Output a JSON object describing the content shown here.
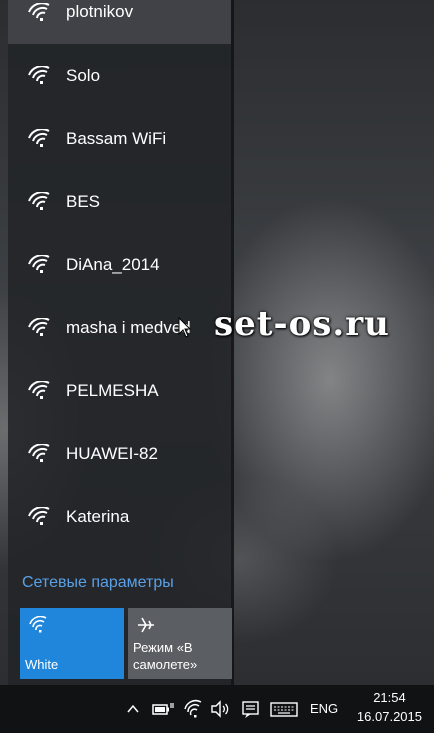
{
  "networks": [
    {
      "name": "plotnikov",
      "selected": true
    },
    {
      "name": "Solo"
    },
    {
      "name": "Bassam WiFi"
    },
    {
      "name": "BES"
    },
    {
      "name": "DiAna_2014"
    },
    {
      "name": "masha i medved"
    },
    {
      "name": "PELMESHA"
    },
    {
      "name": "HUAWEI-82"
    },
    {
      "name": "Katerina"
    }
  ],
  "network_settings_label": "Сетевые параметры",
  "quick_actions": {
    "wifi_label": "White",
    "airplane_label": "Режим «В самолете»"
  },
  "watermark": "set-os.ru",
  "taskbar": {
    "language": "ENG",
    "time": "21:54",
    "date": "16.07.2015"
  },
  "colors": {
    "accent": "#1f86dc",
    "link": "#5aa0e6",
    "tile_inactive": "#5b5e62"
  }
}
